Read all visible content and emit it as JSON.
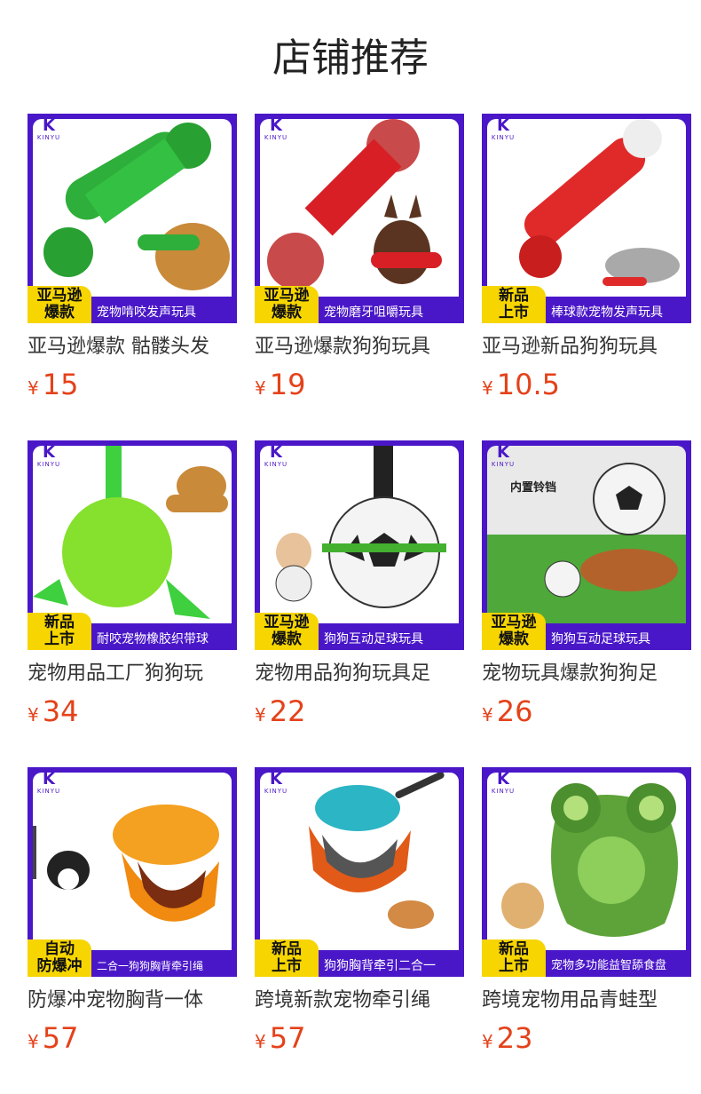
{
  "header": {
    "title": "店铺推荐"
  },
  "brand": {
    "logo_letter": "K",
    "logo_text": "KINYU"
  },
  "colors": {
    "brand_purple": "#4a17c8",
    "badge_yellow": "#f6d500",
    "price_red": "#e4421a"
  },
  "products": [
    {
      "title": "亚马逊爆款 骷髅头发",
      "price_symbol": "¥",
      "price": "15",
      "badge_line1": "亚马逊",
      "badge_line2": "爆款",
      "banner": "宠物啃咬发声玩具",
      "art": "green-bone"
    },
    {
      "title": "亚马逊爆款狗狗玩具",
      "price_symbol": "¥",
      "price": "19",
      "badge_line1": "亚马逊",
      "badge_line2": "爆款",
      "banner": "宠物磨牙咀嚼玩具",
      "art": "red-bone"
    },
    {
      "title": "亚马逊新品狗狗玩具",
      "price_symbol": "¥",
      "price": "10.5",
      "badge_line1": "新品",
      "badge_line2": "上市",
      "banner": "棒球款宠物发声玩具",
      "art": "red-bat"
    },
    {
      "title": "宠物用品工厂狗狗玩",
      "price_symbol": "¥",
      "price": "34",
      "badge_line1": "新品",
      "badge_line2": "上市",
      "banner": "耐咬宠物橡胶织带球",
      "art": "green-ball"
    },
    {
      "title": "宠物用品狗狗玩具足",
      "price_symbol": "¥",
      "price": "22",
      "badge_line1": "亚马逊",
      "badge_line2": "爆款",
      "banner": "狗狗互动足球玩具",
      "art": "soccer"
    },
    {
      "title": "宠物玩具爆款狗狗足",
      "price_symbol": "¥",
      "price": "26",
      "badge_line1": "亚马逊",
      "badge_line2": "爆款",
      "banner": "狗狗互动足球玩具",
      "art": "soccer-field",
      "callout": "内置铃铛"
    },
    {
      "title": "防爆冲宠物胸背一体",
      "price_symbol": "¥",
      "price": "57",
      "badge_line1": "自动",
      "badge_line2": "防爆冲",
      "banner": "二合一狗狗胸背牵引绳",
      "art": "orange-harness"
    },
    {
      "title": "跨境新款宠物牵引绳",
      "price_symbol": "¥",
      "price": "57",
      "badge_line1": "新品",
      "badge_line2": "上市",
      "banner": "狗狗胸背牵引二合一",
      "art": "teal-harness"
    },
    {
      "title": "跨境宠物用品青蛙型",
      "price_symbol": "¥",
      "price": "23",
      "badge_line1": "新品",
      "badge_line2": "上市",
      "banner": "宠物多功能益智舔食盘",
      "art": "frog-mat"
    }
  ]
}
